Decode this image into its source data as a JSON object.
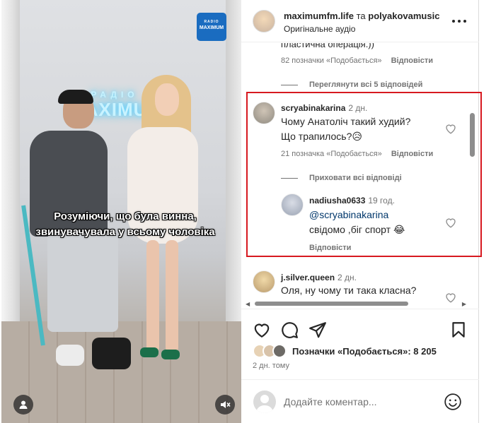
{
  "video": {
    "neon_sign_small": "РАДІО",
    "neon_sign_big": "MAXIMUM",
    "logo_line1": "RADIO",
    "logo_line2": "MAXIMUM",
    "caption_line1": "Розуміючи, що була винна,",
    "caption_line2": "звинувачувала у всьому чоловіка",
    "user_icon": "user-tag-icon",
    "mute_icon": "speaker-muted-icon"
  },
  "header": {
    "author1": "maximumfm.life",
    "and_text": "та",
    "author2": "polyakovamusic",
    "audio": "Оригінальне аудіо",
    "more_icon": "more-dots-icon"
  },
  "comments": {
    "truncated_text": "пластична операція.))",
    "first_meta": {
      "likes": "82 позначки «Подобається»",
      "reply": "Відповісти"
    },
    "view_replies": "Переглянути всі 5 відповідей",
    "main": {
      "user": "scryabinakarina",
      "time": "2 дн.",
      "text_line1": "Чому Анатоліч такий худий?",
      "text_line2": "Що трапилось?😥",
      "likes": "21 позначка «Подобається»",
      "reply": "Відповісти",
      "hide_replies": "Приховати всі відповіді"
    },
    "reply": {
      "user": "nadiusha0633",
      "time": "19 год.",
      "mention": "@scryabinakarina",
      "text": "свідомо ,біг спорт 😂",
      "reply": "Відповісти"
    },
    "next": {
      "user": "j.silver.queen",
      "time": "2 дн.",
      "text": "Оля, ну чому ти така класна?"
    }
  },
  "actions": {
    "likes_text": "Позначки «Подобається»: 8 205",
    "post_time": "2 дн. тому",
    "icons": [
      "heart-icon",
      "comment-icon",
      "share-icon",
      "bookmark-icon"
    ]
  },
  "add_comment": {
    "placeholder": "Додайте коментар...",
    "emoji_icon": "emoji-icon"
  },
  "colors": {
    "highlight": "#d71920",
    "secondary_text": "#737373",
    "mention": "#00376b"
  }
}
